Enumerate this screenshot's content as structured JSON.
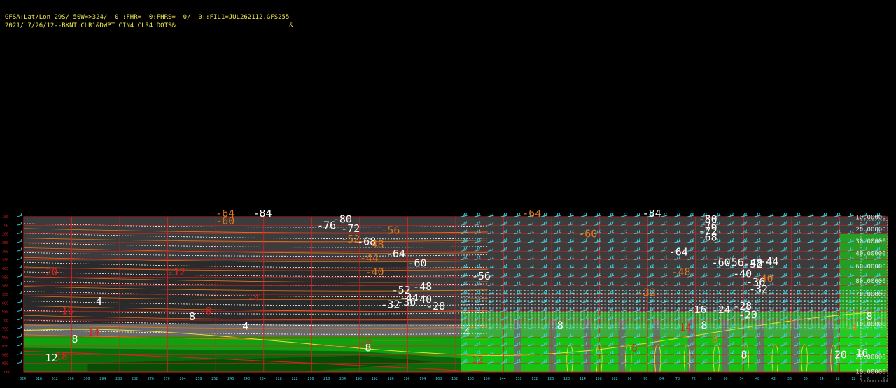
{
  "header": {
    "line1": "GFSA:Lat/Lon 29S/ 50W=>324/  0 :FHR=  0:FHRS=  0/  0::FIL1=JUL262112.GFS255",
    "line2": "2021/ 7/26/12--BKNT CLR1&DWPT CIN4 CLR4 DOTS&                              &"
  },
  "colors": {
    "background": "#000000",
    "header_text": "#f2e64a",
    "grid_red": "#e02020",
    "wind_barb": "#38d8e8",
    "ground_dark": "#0a6a0a",
    "ground_mid": "#10a010",
    "ground_bright": "#18e018",
    "column_gray": "#6a6a6a",
    "upper_gray": "#3c3c3c",
    "temp_white": "#ffffff",
    "temp_orange": "#e07820",
    "dewpoint_yellow": "#e8e030"
  },
  "chart_data": {
    "type": "heatmap",
    "title": "",
    "xlabel": "",
    "ylabel": "",
    "pressure_levels": [
      100,
      150,
      200,
      250,
      300,
      350,
      400,
      450,
      500,
      550,
      600,
      650,
      700,
      750,
      800,
      850,
      900,
      950,
      1000
    ],
    "longitude_ticks": [
      324,
      318,
      312,
      306,
      300,
      294,
      288,
      282,
      276,
      270,
      264,
      258,
      252,
      246,
      240,
      234,
      228,
      222,
      216,
      210,
      204,
      198,
      192,
      186,
      180,
      174,
      168,
      162,
      156,
      150,
      144,
      138,
      132,
      126,
      120,
      114,
      108,
      102,
      96,
      90,
      84,
      78,
      72,
      66,
      60,
      54,
      48,
      42,
      36,
      30,
      24,
      18,
      12,
      6,
      0
    ],
    "xlim": [
      324,
      0
    ],
    "ylim": [
      1000,
      100
    ],
    "temperature_labels": [
      {
        "value": "-84",
        "lon": 238,
        "p": 100
      },
      {
        "value": "-80",
        "lon": 208,
        "p": 135
      },
      {
        "value": "-76",
        "lon": 214,
        "p": 170
      },
      {
        "value": "-72",
        "lon": 205,
        "p": 190
      },
      {
        "value": "-68",
        "lon": 199,
        "p": 265
      },
      {
        "value": "-64",
        "lon": 188,
        "p": 335
      },
      {
        "value": "-60",
        "lon": 180,
        "p": 390
      },
      {
        "value": "-56",
        "lon": 156,
        "p": 465
      },
      {
        "value": "-52",
        "lon": 186,
        "p": 545
      },
      {
        "value": "-48",
        "lon": 178,
        "p": 525
      },
      {
        "value": "-44",
        "lon": 183,
        "p": 590
      },
      {
        "value": "-40",
        "lon": 178,
        "p": 600
      },
      {
        "value": "-36",
        "lon": 184,
        "p": 615
      },
      {
        "value": "-32",
        "lon": 190,
        "p": 630
      },
      {
        "value": "-28",
        "lon": 173,
        "p": 640
      },
      {
        "value": "-84",
        "lon": 92,
        "p": 100
      },
      {
        "value": "-80",
        "lon": 71,
        "p": 135
      },
      {
        "value": "-76",
        "lon": 71,
        "p": 175
      },
      {
        "value": "-72",
        "lon": 71,
        "p": 205
      },
      {
        "value": "-68",
        "lon": 71,
        "p": 240
      },
      {
        "value": "-64",
        "lon": 82,
        "p": 325
      },
      {
        "value": "-60",
        "lon": 66,
        "p": 385
      },
      {
        "value": "-56",
        "lon": 61,
        "p": 385
      },
      {
        "value": "-52",
        "lon": 54,
        "p": 395
      },
      {
        "value": "-48",
        "lon": 54,
        "p": 390
      },
      {
        "value": "-44",
        "lon": 48,
        "p": 380
      },
      {
        "value": "-40",
        "lon": 58,
        "p": 450
      },
      {
        "value": "-36",
        "lon": 53,
        "p": 500
      },
      {
        "value": "-32",
        "lon": 52,
        "p": 540
      },
      {
        "value": "-28",
        "lon": 58,
        "p": 640
      },
      {
        "value": "-24",
        "lon": 66,
        "p": 660
      },
      {
        "value": "-20",
        "lon": 56,
        "p": 690
      },
      {
        "value": "-16",
        "lon": 75,
        "p": 660
      },
      {
        "value": "4",
        "lon": 297,
        "p": 610
      },
      {
        "value": "8",
        "lon": 262,
        "p": 700
      },
      {
        "value": "4",
        "lon": 242,
        "p": 755
      },
      {
        "value": "8",
        "lon": 306,
        "p": 830
      },
      {
        "value": "8",
        "lon": 196,
        "p": 880
      },
      {
        "value": "4",
        "lon": 159,
        "p": 790
      },
      {
        "value": "8",
        "lon": 124,
        "p": 750
      },
      {
        "value": "8",
        "lon": 70,
        "p": 750
      },
      {
        "value": "8",
        "lon": 55,
        "p": 920
      },
      {
        "value": "8",
        "lon": 8,
        "p": 700
      },
      {
        "value": "16",
        "lon": 12,
        "p": 910
      },
      {
        "value": "12",
        "lon": 316,
        "p": 940
      },
      {
        "value": "20",
        "lon": 20,
        "p": 920
      }
    ],
    "dewpoint_labels": [
      {
        "value": "-64",
        "lon": 252,
        "p": 100
      },
      {
        "value": "-60",
        "lon": 252,
        "p": 145
      },
      {
        "value": "-56",
        "lon": 190,
        "p": 200
      },
      {
        "value": "-52",
        "lon": 205,
        "p": 250
      },
      {
        "value": "-48",
        "lon": 196,
        "p": 280
      },
      {
        "value": "-44",
        "lon": 198,
        "p": 360
      },
      {
        "value": "-40",
        "lon": 196,
        "p": 440
      },
      {
        "value": "-64",
        "lon": 137,
        "p": 100
      },
      {
        "value": "-60",
        "lon": 116,
        "p": 220
      },
      {
        "value": "-48",
        "lon": 81,
        "p": 440
      },
      {
        "value": "-40",
        "lon": 50,
        "p": 480
      },
      {
        "value": "-32",
        "lon": 94,
        "p": 560
      },
      {
        "value": "8",
        "lon": 66,
        "p": 830
      },
      {
        "value": "-4",
        "lon": 16,
        "p": 760
      }
    ],
    "contour_labels_red": [
      {
        "value": "-20",
        "lon": 318,
        "p": 440
      },
      {
        "value": "-16",
        "lon": 312,
        "p": 665
      },
      {
        "value": "-12",
        "lon": 270,
        "p": 440
      },
      {
        "value": "-8",
        "lon": 258,
        "p": 665
      },
      {
        "value": "-4",
        "lon": 240,
        "p": 590
      },
      {
        "value": "14",
        "lon": 300,
        "p": 790
      },
      {
        "value": "18",
        "lon": 312,
        "p": 930
      },
      {
        "value": "10",
        "lon": 198,
        "p": 840
      },
      {
        "value": "12",
        "lon": 156,
        "p": 950
      },
      {
        "value": "14",
        "lon": 78,
        "p": 760
      },
      {
        "value": "8",
        "lon": 96,
        "p": 880
      }
    ],
    "mixing_ratio_labels": [
      {
        "value": "10.00000",
        "lon": 12,
        "p": 115
      },
      {
        "value": "20.00000",
        "lon": 12,
        "p": 185
      },
      {
        "value": "30.00000",
        "lon": 12,
        "p": 255
      },
      {
        "value": "40.00000",
        "lon": 12,
        "p": 325
      },
      {
        "value": "60.00000",
        "lon": 12,
        "p": 400
      },
      {
        "value": "80.00000",
        "lon": 12,
        "p": 485
      },
      {
        "value": "70.00000",
        "lon": 12,
        "p": 560
      },
      {
        "value": "10.00000",
        "lon": 12,
        "p": 735
      },
      {
        "value": "20.00000",
        "lon": 12,
        "p": 925
      },
      {
        "value": "10.00000",
        "lon": 12,
        "p": 1010
      }
    ]
  }
}
